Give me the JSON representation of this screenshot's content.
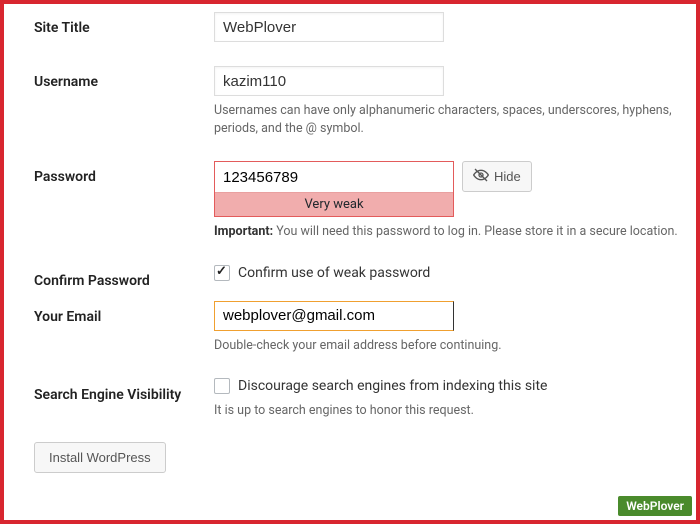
{
  "site_title": {
    "label": "Site Title",
    "value": "WebPlover"
  },
  "username": {
    "label": "Username",
    "value": "kazim110",
    "help": "Usernames can have only alphanumeric characters, spaces, underscores, hyphens, periods, and the @ symbol."
  },
  "password": {
    "label": "Password",
    "value": "123456789",
    "strength": "Very weak",
    "hide_label": "Hide",
    "important_prefix": "Important:",
    "important_text": " You will need this password to log in. Please store it in a secure location."
  },
  "confirm": {
    "label": "Confirm Password",
    "checkbox_label": "Confirm use of weak password",
    "checked": true
  },
  "email": {
    "label": "Your Email",
    "value": "webplover@gmail.com",
    "help": "Double-check your email address before continuing."
  },
  "sev": {
    "label": "Search Engine Visibility",
    "checkbox_label": "Discourage search engines from indexing this site",
    "help": "It is up to search engines to honor this request."
  },
  "install_label": "Install WordPress",
  "watermark": "WebPlover"
}
